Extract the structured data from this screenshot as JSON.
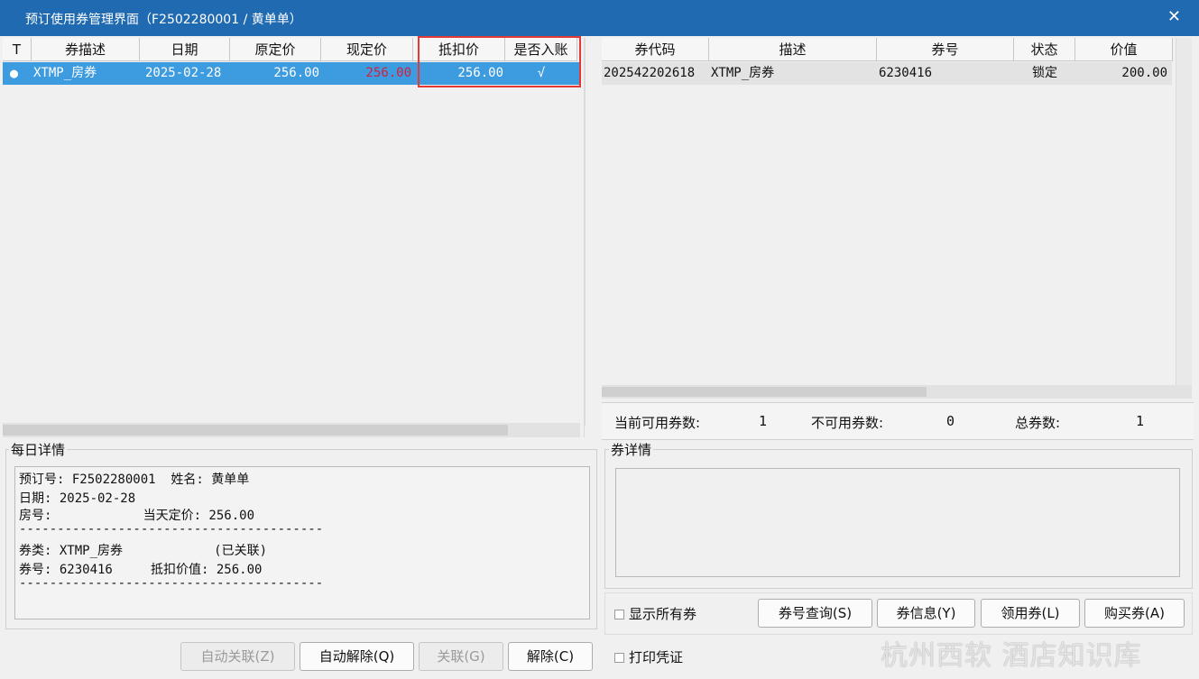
{
  "window": {
    "title": "预订使用券管理界面（F2502280001 / 黄单单）",
    "close_glyph": "✕"
  },
  "left_grid": {
    "headers": [
      "T",
      "券描述",
      "日期",
      "原定价",
      "现定价",
      "抵扣价",
      "是否入账"
    ],
    "rows": [
      {
        "t_glyph": "●",
        "desc": "XTMP_房券",
        "date": "2025-02-28",
        "orig_price": "256.00",
        "cur_price": "256.00",
        "deduct_price": "256.00",
        "posted": "√"
      }
    ]
  },
  "right_grid": {
    "headers": [
      "券代码",
      "描述",
      "券号",
      "状态",
      "价值"
    ],
    "rows": [
      {
        "code": "202542202618",
        "desc": "XTMP_房券",
        "number": "6230416",
        "status": "锁定",
        "value": "200.00"
      }
    ]
  },
  "stats": {
    "available_label": "当前可用券数:",
    "available_value": "1",
    "unavailable_label": "不可用券数:",
    "unavailable_value": "0",
    "total_label": "总券数:",
    "total_value": "1"
  },
  "daily_detail": {
    "title": "每日详情",
    "lines": [
      "预订号: F2502280001  姓名: 黄单单",
      "日期: 2025-02-28",
      "房号:            当天定价: 256.00",
      "----------------------------------------",
      "券类: XTMP_房券            (已关联)",
      "券号: 6230416     抵扣价值: 256.00",
      "----------------------------------------"
    ]
  },
  "coupon_detail": {
    "title": "券详情"
  },
  "buttons": {
    "auto_link": "自动关联(Z)",
    "auto_unlink": "自动解除(Q)",
    "link": "关联(G)",
    "unlink": "解除(C)",
    "query": "券号查询(S)",
    "info": "券信息(Y)",
    "receive": "领用券(L)",
    "buy": "购买券(A)"
  },
  "checkboxes": {
    "show_all": "显示所有券",
    "print_voucher": "打印凭证"
  },
  "watermark": "杭州西软 酒店知识库",
  "colors": {
    "titlebar": "#1f6ab0",
    "selection": "#3d9be0",
    "cur_price_red": "#d3203a",
    "highlight_border": "#e53935"
  }
}
